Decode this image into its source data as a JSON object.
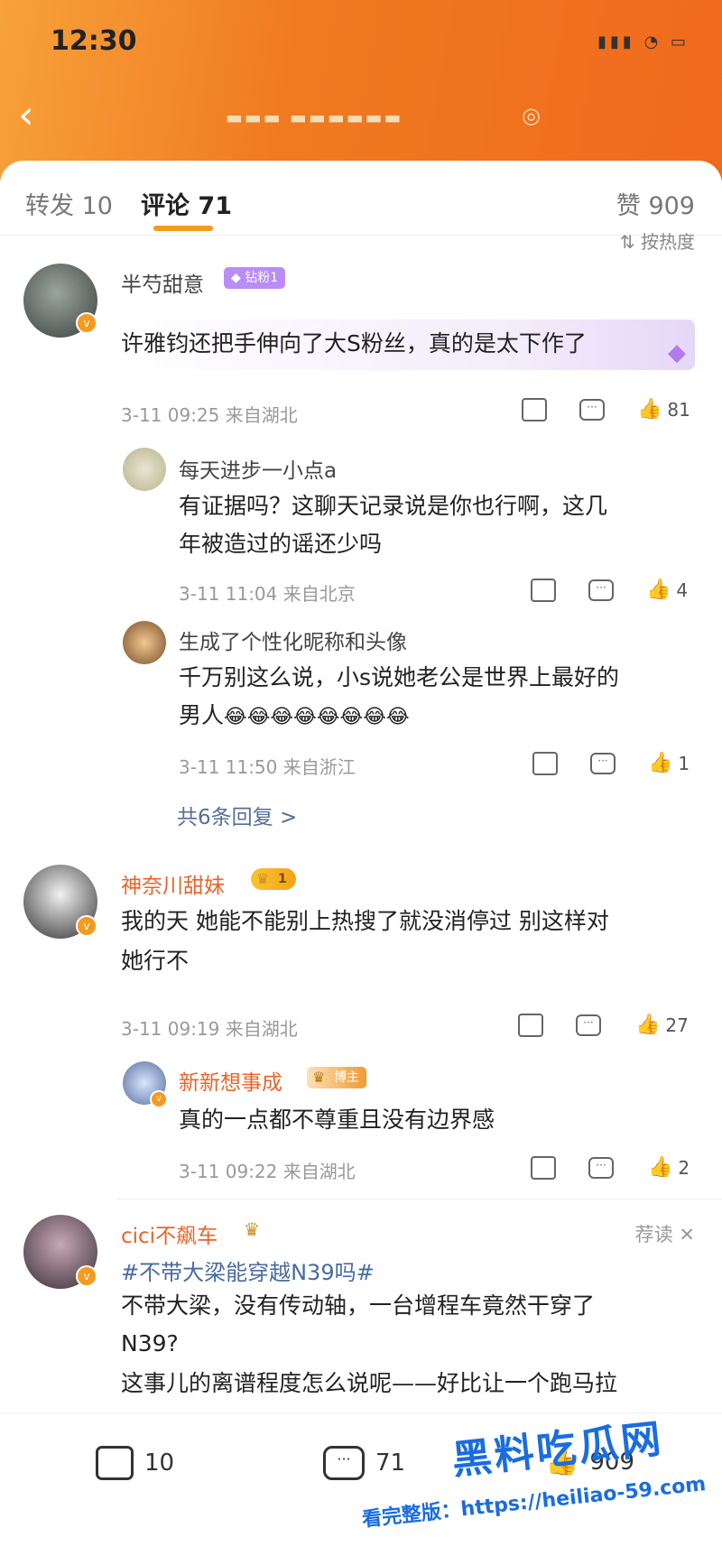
{
  "status_bar": {
    "time": "12:30"
  },
  "header": {
    "back_glyph": "‹"
  },
  "tabs": {
    "forward_label": "转发",
    "forward_count": "10",
    "comment_label": "评论",
    "comment_count": "71",
    "like_label": "赞",
    "like_count": "909"
  },
  "sort_label": "按热度",
  "comments": [
    {
      "name": "半芍甜意",
      "badge": "钻粉1",
      "text": "许雅钧还把手伸向了大S粉丝，真的是太下作了",
      "meta": "3-11 09:25 来自湖北",
      "likes": "81",
      "replies": [
        {
          "name": "每天进步一小点a",
          "text_line1": "有证据吗？这聊天记录说是你也行啊，这几",
          "text_line2": "年被造过的谣还少吗",
          "meta": "3-11 11:04 来自北京",
          "likes": "4"
        },
        {
          "name": "生成了个性化昵称和头像",
          "text_line1": "千万别这么说，小s说她老公是世界上最好的",
          "text_line2": "男人",
          "emoji": "😂😂😂😂😂😂😂😂",
          "meta": "3-11 11:50 来自浙江",
          "likes": "1"
        }
      ],
      "more_replies": "共6条回复 >"
    },
    {
      "name": "神奈川甜妹",
      "badge": "1",
      "text_line1": "我的天 她能不能别上热搜了就没消停过 别这样对",
      "text_line2": "她行不",
      "meta": "3-11 09:19 来自湖北",
      "likes": "27",
      "replies": [
        {
          "name": "新新想事成",
          "badge": "博主",
          "text_line1": "真的一点都不尊重且没有边界感",
          "meta": "3-11 09:22 来自湖北",
          "likes": "2"
        }
      ]
    },
    {
      "name": "cici不飙车",
      "recommend": "荐读 ✕",
      "hashtag": "#不带大梁能穿越N39吗#",
      "text_line1": "不带大梁，没有传动轴，一台增程车竟然干穿了",
      "text_line2": "N39?",
      "text_line3": "这事儿的离谱程度怎么说呢——好比让一个跑马拉"
    }
  ],
  "bottom_bar": {
    "share_count": "10",
    "comment_count": "71",
    "like_count": "909"
  },
  "watermark": {
    "title": "黑料吃瓜网",
    "subtitle": "看完整版：https://heiliao-59.com"
  },
  "icons": [
    "back-icon",
    "share-icon",
    "comment-icon",
    "like-icon",
    "verified-icon",
    "crown-icon"
  ]
}
